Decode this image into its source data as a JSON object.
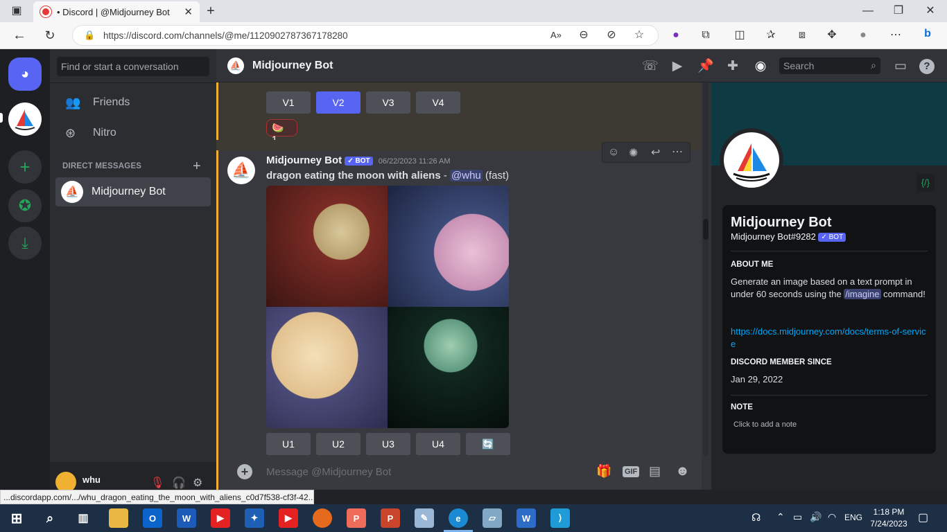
{
  "browser": {
    "tab_title": "• Discord | @Midjourney Bot",
    "url": "https://discord.com/channels/@me/1120902787367178280",
    "status_url": "...discordapp.com/.../whu_dragon_eating_the_moon_with_aliens_c0d7f538-cf3f-42..."
  },
  "sidebar": {
    "search_placeholder": "Find or start a conversation",
    "friends_label": "Friends",
    "nitro_label": "Nitro",
    "dm_header": "DIRECT MESSAGES",
    "add_dm": "+",
    "dm_name": "Midjourney Bot",
    "user_name": "whu"
  },
  "header": {
    "channel_name": "Midjourney Bot",
    "search_placeholder": "Search"
  },
  "messages": {
    "prev_buttons": [
      "V1",
      "V2",
      "V3",
      "V4"
    ],
    "reaction_count": "1",
    "reaction_emoji": "🍉",
    "author": "Midjourney Bot",
    "bot_tag": "✓ BOT",
    "timestamp": "06/22/2023 11:26 AM",
    "prompt": "dragon eating the moon with aliens",
    "separator": " - ",
    "mention": "@whu",
    "speed": "(fast)",
    "upscale_buttons": [
      "U1",
      "U2",
      "U3",
      "U4"
    ],
    "reroll_icon": "🔄"
  },
  "composer": {
    "placeholder": "Message @Midjourney Bot",
    "gif_label": "GIF"
  },
  "profile": {
    "name": "Midjourney Bot",
    "tag": "Midjourney Bot#9282",
    "bot_tag": "✓ BOT",
    "about_header": "ABOUT ME",
    "about_text_1": "Generate an image based on a text prompt in under 60 seconds using the",
    "about_cmd": "/imagine",
    "about_text_2": "command!",
    "link": "https://docs.midjourney.com/docs/terms-of-service",
    "since_header": "DISCORD MEMBER SINCE",
    "since_date": "Jan 29, 2022",
    "note_header": "NOTE",
    "note_placeholder": "Click to add a note",
    "code_icon": "{/}"
  },
  "taskbar": {
    "time": "1:18 PM",
    "date": "7/24/2023",
    "lang": "ENG"
  },
  "colors": {
    "discord_blurple": "#5865f2",
    "highlight_bar": "#f0b132"
  }
}
